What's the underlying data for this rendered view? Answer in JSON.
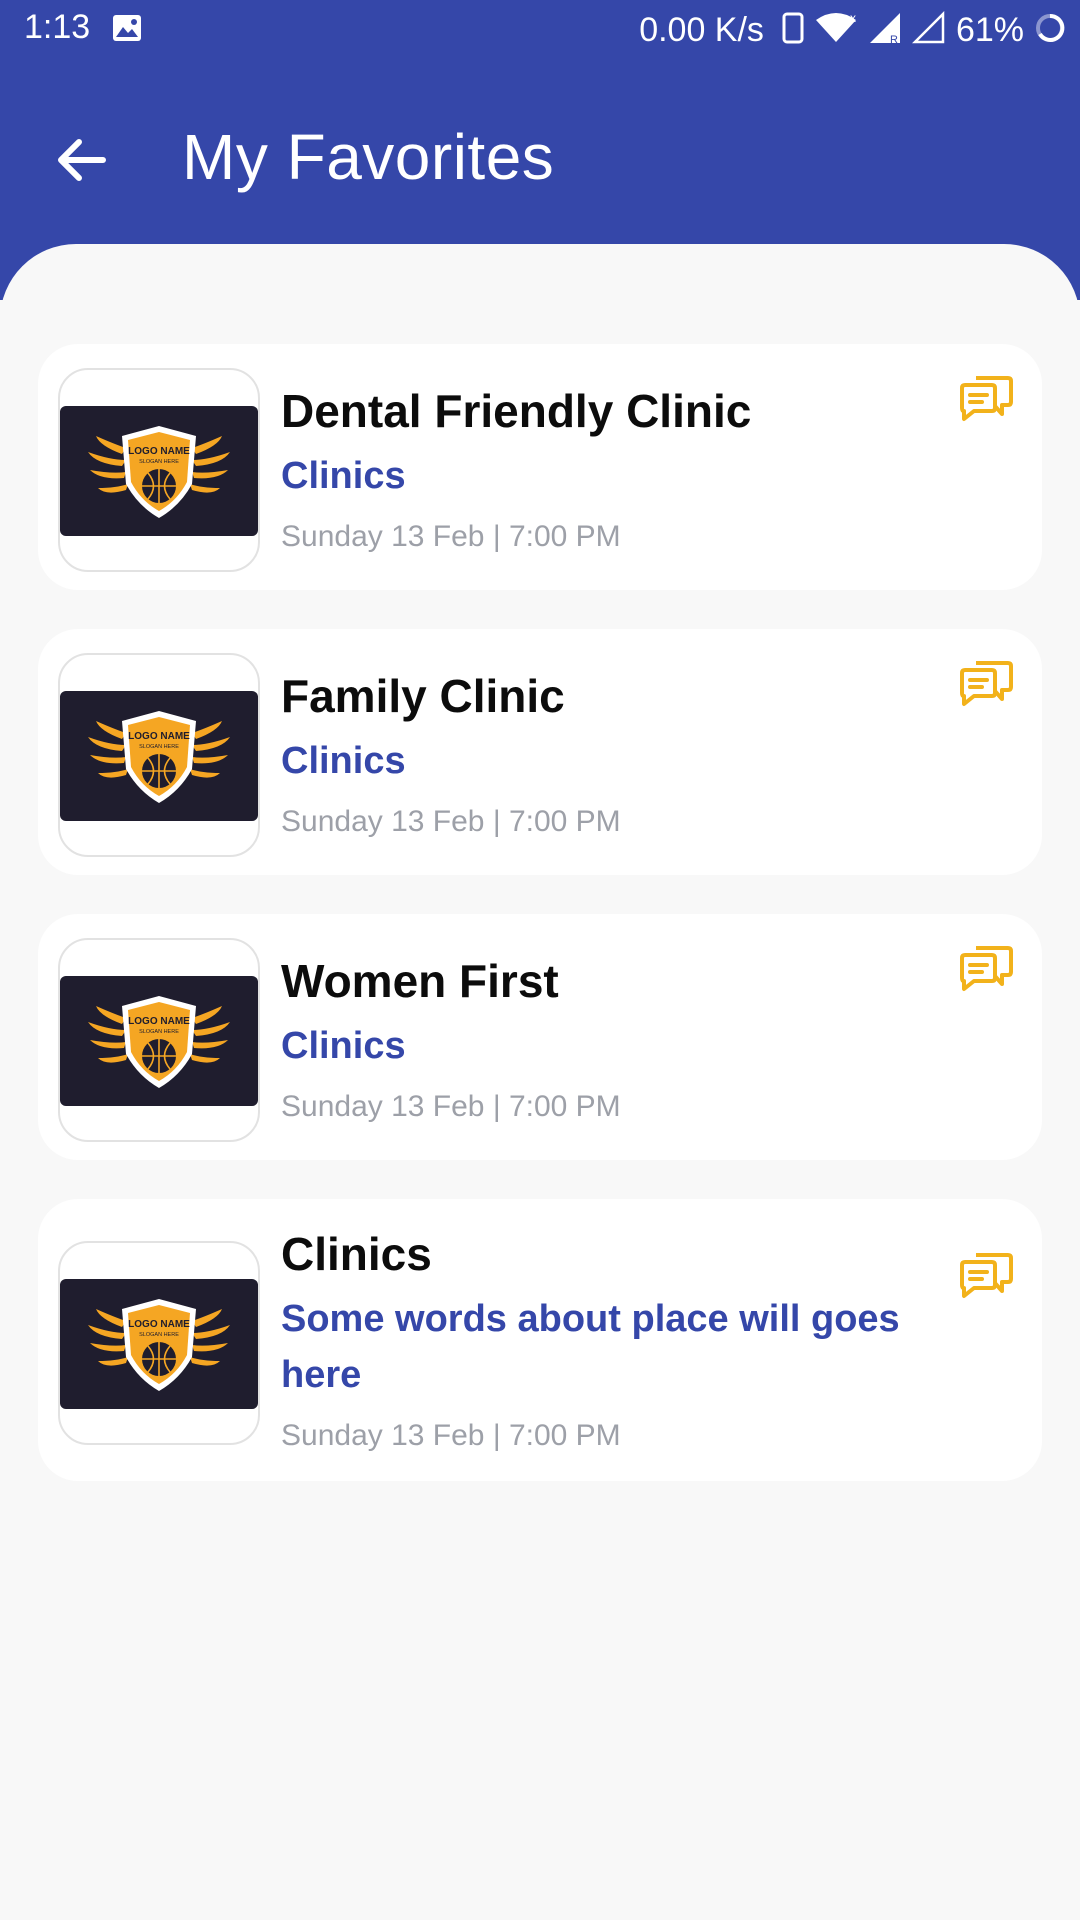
{
  "status_bar": {
    "time": "1:13",
    "network_speed": "0.00 K/s",
    "battery": "61%",
    "icons": [
      "gallery-icon",
      "phone-icon",
      "wifi-icon",
      "signal-icon",
      "signal-empty-icon",
      "battery-ring-icon"
    ]
  },
  "header": {
    "title": "My Favorites",
    "back_icon": "arrow-left-icon"
  },
  "colors": {
    "primary": "#3547a9",
    "accent": "#f2b21b",
    "background": "#f8f8f8",
    "date_text": "#9da0a8"
  },
  "favorites": [
    {
      "title": "Dental Friendly Clinic",
      "category": "Clinics",
      "date": "Sunday 13 Feb | 7:00 PM",
      "logo_text": "LOGO NAME",
      "logo_slogan": "SLOGAN HERE"
    },
    {
      "title": "Family Clinic",
      "category": "Clinics",
      "date": "Sunday 13 Feb | 7:00 PM",
      "logo_text": "LOGO NAME",
      "logo_slogan": "SLOGAN HERE"
    },
    {
      "title": "Women First",
      "category": "Clinics",
      "date": "Sunday 13 Feb | 7:00 PM",
      "logo_text": "LOGO NAME",
      "logo_slogan": "SLOGAN HERE"
    },
    {
      "title": "Clinics",
      "category": "Some words about place will goes here",
      "date": "Sunday 13 Feb | 7:00 PM",
      "logo_text": "LOGO NAME",
      "logo_slogan": "SLOGAN HERE"
    }
  ]
}
